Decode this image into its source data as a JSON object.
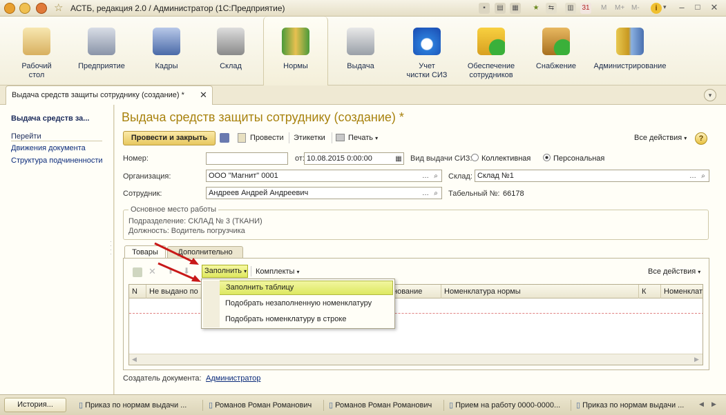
{
  "window": {
    "title": "АСТБ, редакция 2.0 / Администратор  (1С:Предприятие)"
  },
  "sections": [
    {
      "line1": "Рабочий",
      "line2": "стол",
      "icon": "desk-icon"
    },
    {
      "line1": "Предприятие",
      "line2": "",
      "icon": "building-icon"
    },
    {
      "line1": "Кадры",
      "line2": "",
      "icon": "people-icon"
    },
    {
      "line1": "Склад",
      "line2": "",
      "icon": "shelf-icon"
    },
    {
      "line1": "Нормы",
      "line2": "",
      "icon": "binders-icon"
    },
    {
      "line1": "Выдача",
      "line2": "",
      "icon": "worker-icon"
    },
    {
      "line1": "Учет",
      "line2": "чистки СИЗ",
      "icon": "drop-icon"
    },
    {
      "line1": "Обеспечение",
      "line2": "сотрудников",
      "icon": "worker-add-icon"
    },
    {
      "line1": "Снабжение",
      "line2": "",
      "icon": "box-add-icon"
    },
    {
      "line1": "Администрирование",
      "line2": "",
      "icon": "database-icon"
    }
  ],
  "doc_tab": "Выдача средств защиты сотруднику (создание) *",
  "nav": {
    "current": "Выдача средств за...",
    "goto": "Перейти",
    "links": [
      "Движения документа",
      "Структура подчиненности"
    ]
  },
  "form": {
    "title": "Выдача средств защиты сотруднику (создание) *",
    "post_close": "Провести и закрыть",
    "post": "Провести",
    "labels_btn": "Этикетки",
    "print": "Печать",
    "all_actions": "Все действия",
    "number_label": "Номер:",
    "number_value": "",
    "date_label": "от:",
    "date_value": "10.08.2015  0:00:00",
    "issue_type_label": "Вид выдачи СИЗ:",
    "opt_collective": "Коллективная",
    "opt_personal": "Персональная",
    "org_label": "Организация:",
    "org_value": "ООО \"Магнит\" 0001",
    "warehouse_label": "Склад:",
    "warehouse_value": "Склад №1",
    "employee_label": "Сотрудник:",
    "employee_value": "Андреев Андрей Андреевич",
    "tabnum_label": "Табельный №:",
    "tabnum_value": "66178",
    "group_title": "Основное место работы",
    "dept": "Подразделение: СКЛАД № 3 (ТКАНИ)",
    "position": "Должность: Водитель погрузчика",
    "tab_goods": "Товары",
    "tab_extra": "Дополнительно",
    "fill": "Заполнить",
    "kits": "Комплекты",
    "table_all_actions": "Все действия",
    "columns": [
      "N",
      "Не выдано по",
      "нование",
      "Номенклатура нормы",
      "К",
      "Номенклатура"
    ],
    "menu": [
      "Заполнить таблицу",
      "Подобрать незаполненную номенклатуру",
      "Подобрать номенклатуру в строке"
    ],
    "author_label": "Создатель документа:",
    "author_value": "Администратор"
  },
  "taskbar": {
    "history": "История...",
    "items": [
      "Приказ по нормам выдачи ...",
      "Романов Роман Романович",
      "Романов Роман Романович",
      "Прием на работу 0000-0000...",
      "Приказ по нормам выдачи ..."
    ]
  },
  "colors": {
    "accent": "#b08a10",
    "link": "#0a2a7a",
    "highlight": "#e8f05a",
    "arrow": "#c81818"
  }
}
